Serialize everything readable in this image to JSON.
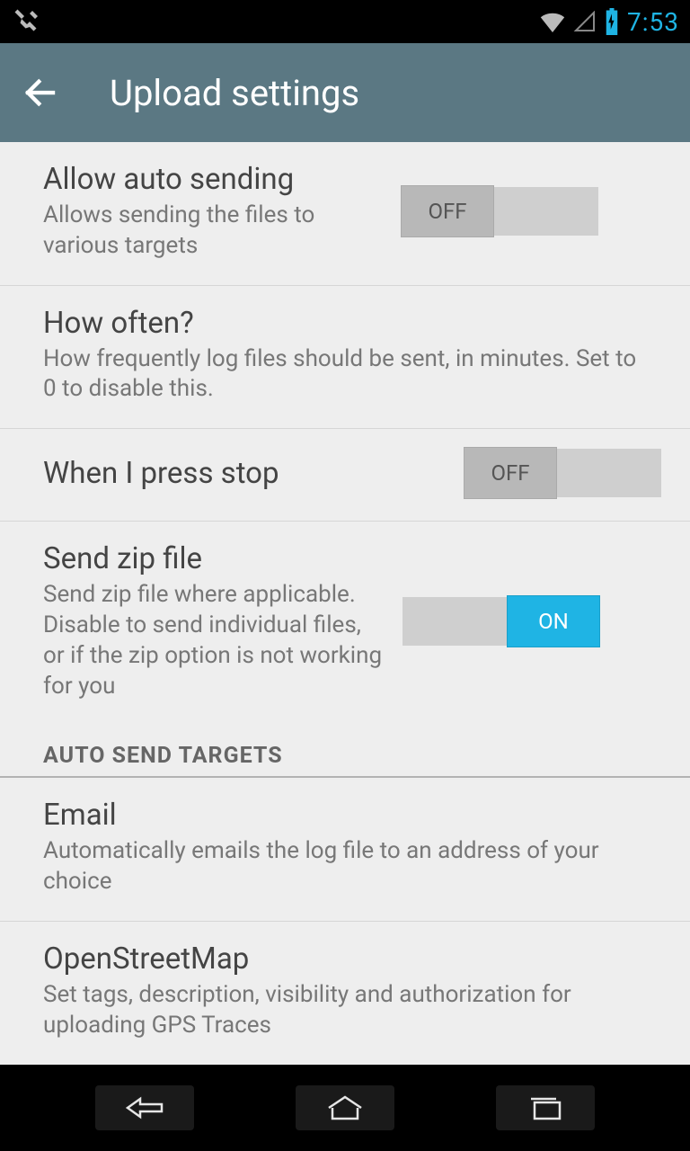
{
  "status": {
    "time": "7:53"
  },
  "header": {
    "title": "Upload settings"
  },
  "settings": {
    "allow_auto_send": {
      "title": "Allow auto sending",
      "desc": "Allows sending the files to various targets",
      "toggle": "OFF"
    },
    "how_often": {
      "title": "How often?",
      "desc": "How frequently log files should be sent, in minutes. Set to 0 to disable this."
    },
    "when_stop": {
      "title": "When I press stop",
      "toggle": "OFF"
    },
    "send_zip": {
      "title": "Send zip file",
      "desc": "Send zip file where applicable. Disable to send individual files, or if the zip option is not working for you",
      "toggle": "ON"
    }
  },
  "section": {
    "auto_send_targets": "AUTO SEND TARGETS"
  },
  "targets": {
    "email": {
      "title": "Email",
      "desc": "Automatically emails the log file to an address of your choice"
    },
    "osm": {
      "title": "OpenStreetMap",
      "desc": "Set tags, description, visibility and authorization for uploading GPS Traces"
    }
  }
}
